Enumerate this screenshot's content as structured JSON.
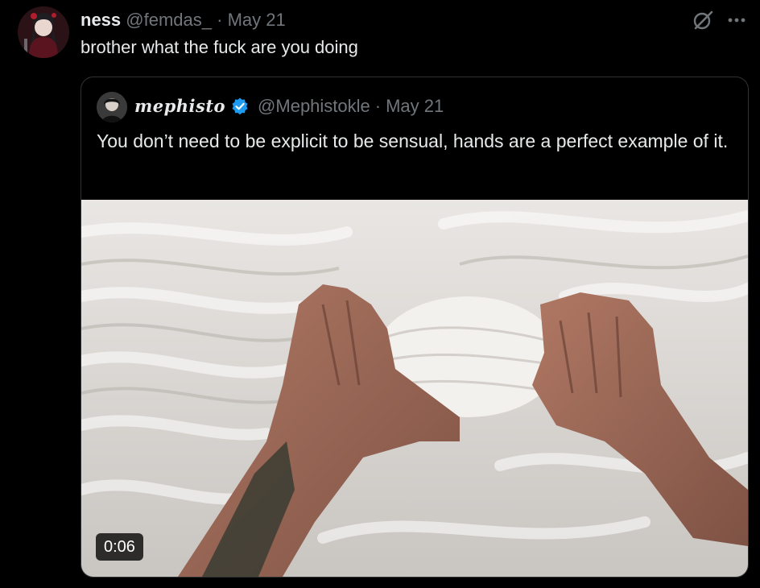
{
  "tweet": {
    "display_name": "ness",
    "handle": "@femdas_",
    "separator": "·",
    "date": "May 21",
    "text": "brother what the fuck are you doing",
    "avatar_icon": "user-avatar",
    "actions": [
      "grok-icon",
      "more-icon"
    ]
  },
  "quoted_tweet": {
    "display_name": "mephisto",
    "verified": true,
    "verified_color": "#1d9bf0",
    "handle": "@Mephistokle",
    "separator": "·",
    "date": "May 21",
    "text": "You don’t need to be explicit to be sensual, hands are a perfect example of it.",
    "video": {
      "duration": "0:06"
    }
  },
  "colors": {
    "background": "#000000",
    "text": "#e7e9ea",
    "secondary_text": "#71767b",
    "border": "#2f3336"
  }
}
